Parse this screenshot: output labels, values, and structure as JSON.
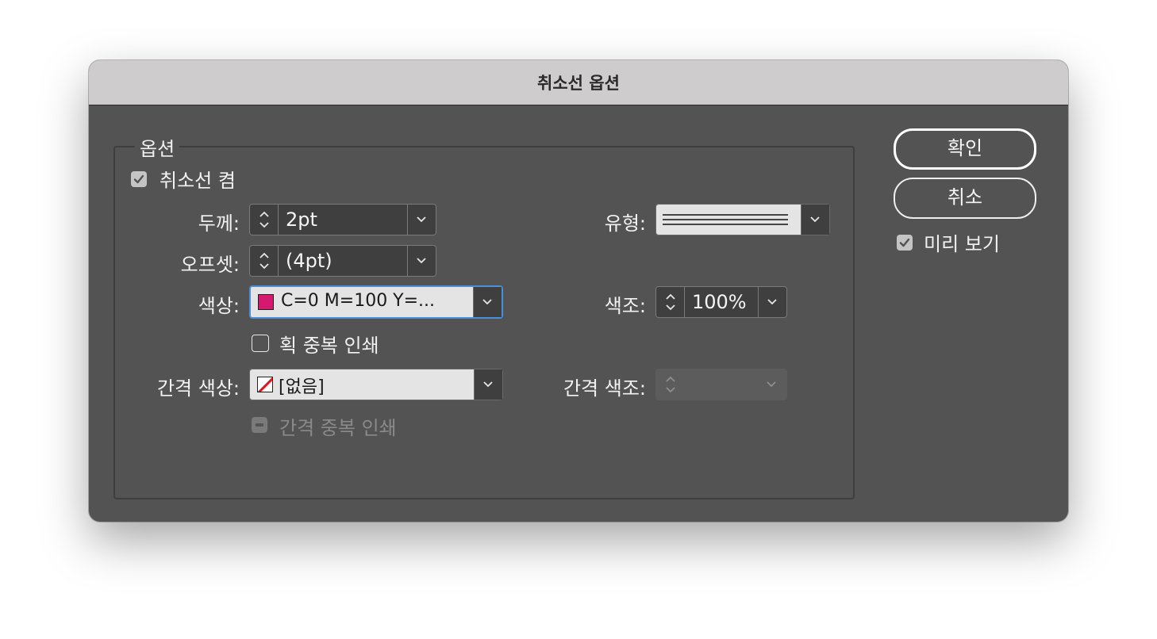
{
  "dialog": {
    "title": "취소선 옵션"
  },
  "options": {
    "group_label": "옵션",
    "strike_on_label": "취소선 켬",
    "weight_label": "두께:",
    "weight_value": "2pt",
    "offset_label": "오프셋:",
    "offset_value": "(4pt)",
    "color_label": "색상:",
    "color_value": "C=0 M=100 Y=...",
    "color_swatch": "#d4196f",
    "overprint_stroke_label": "획 중복 인쇄",
    "gap_color_label": "간격 색상:",
    "gap_color_value": "[없음]",
    "overprint_gap_label": "간격 중복 인쇄",
    "type_label": "유형:",
    "tint_label": "색조:",
    "tint_value": "100%",
    "gap_tint_label": "간격 색조:"
  },
  "buttons": {
    "ok_label": "확인",
    "cancel_label": "취소",
    "preview_label": "미리 보기"
  }
}
